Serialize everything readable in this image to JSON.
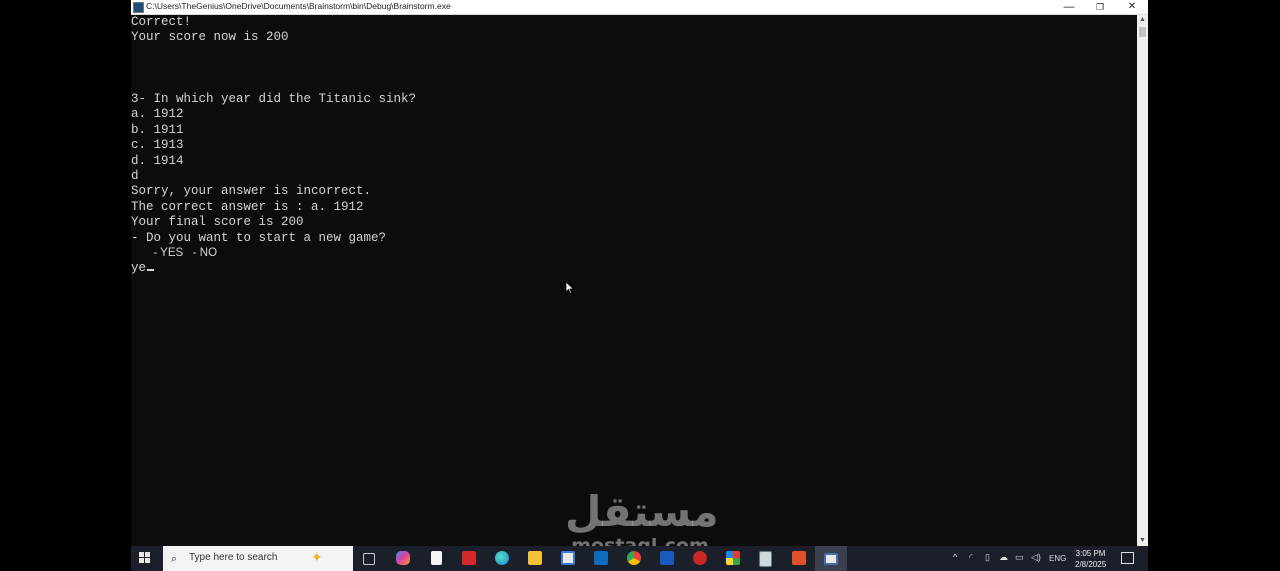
{
  "window": {
    "title": "C:\\Users\\TheGenius\\OneDrive\\Documents\\Brainstorm\\bin\\Debug\\Brainstorm.exe",
    "minimize": "—",
    "restore": "❐",
    "close": "✕"
  },
  "console": {
    "lines": [
      "Correct!",
      "Your score now is 200",
      "",
      "",
      "",
      "3- In which year did the Titanic sink?",
      "a. 1912",
      "b. 1911",
      "c. 1913",
      "d. 1914",
      "d",
      "Sorry, your answer is incorrect.",
      "The correct answer is : a. 1912",
      "Your final score is 200",
      "- Do you want to start a new game?",
      "       - YES   - NO",
      "ye"
    ]
  },
  "watermark": {
    "arabic": "مستقل",
    "latin": "mostaql.com"
  },
  "taskbar": {
    "search_placeholder": "Type here to search",
    "language": "ENG",
    "time": "3:05 PM",
    "date": "2/8/2025",
    "icons": [
      "task-view-icon",
      "copilot-icon",
      "notepad-icon",
      "acrobat-icon",
      "edge-icon",
      "file-explorer-icon",
      "store-icon",
      "outlook-icon",
      "chrome-icon",
      "word-icon",
      "app-red-icon",
      "app-grid-icon",
      "calculator-icon",
      "app-orange-icon",
      "console-app-icon"
    ]
  },
  "colors": {
    "console_bg": "#0c0c0c",
    "console_text": "#d4d4d4",
    "taskbar_bg": "#1b1f2a"
  }
}
